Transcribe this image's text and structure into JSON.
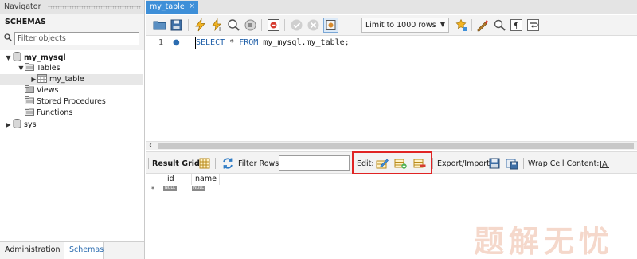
{
  "navigator": {
    "header": "Navigator",
    "section_title": "SCHEMAS",
    "refresh_icon": "refresh-icon",
    "filter_placeholder": "Filter objects",
    "tree": {
      "my_mysql": "my_mysql",
      "tables": "Tables",
      "my_table": "my_table",
      "views": "Views",
      "stored_procedures": "Stored Procedures",
      "functions": "Functions",
      "sys": "sys"
    },
    "tabs": {
      "administration": "Administration",
      "schemas": "Schemas"
    }
  },
  "editor": {
    "tab_title": "my_table",
    "tab_close": "×",
    "limit_select": "Limit to 1000 rows",
    "line_number": "1",
    "sql": {
      "kw_select": "SELECT",
      "star": " * ",
      "kw_from": "FROM",
      "rest": " my_mysql.my_table;"
    }
  },
  "results": {
    "result_grid": "Result Grid",
    "filter_rows": "Filter Rows:",
    "edit": "Edit:",
    "export_import": "Export/Import:",
    "wrap_cell": "Wrap Cell Content:",
    "columns": [
      "id",
      "name"
    ],
    "null_label": "NULL",
    "row_marker": "*"
  },
  "watermark": "题解无忧",
  "colors": {
    "accent": "#3e8fd8",
    "highlight": "#e02424"
  }
}
